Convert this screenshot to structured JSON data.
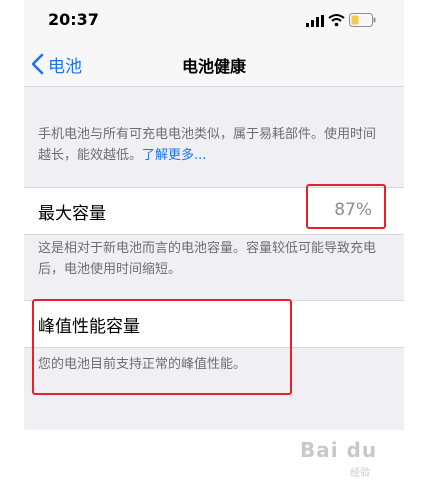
{
  "status_bar": {
    "time": "20:37"
  },
  "nav": {
    "back_label": "电池",
    "title": "电池健康"
  },
  "intro": {
    "text": "手机电池与所有可充电电池类似，属于易耗部件。使用时间越长，能效越低。",
    "link": "了解更多..."
  },
  "max_capacity": {
    "label": "最大容量",
    "value": "87%",
    "footnote": "这是相对于新电池而言的电池容量。容量较低可能导致充电后，电池使用时间缩短。"
  },
  "peak_performance": {
    "label": "峰值性能容量",
    "footnote": "您的电池目前支持正常的峰值性能。"
  },
  "watermark": {
    "brand": "Bai du",
    "sub": "经验"
  },
  "colors": {
    "accent": "#1b74e9",
    "highlight": "#e8202a",
    "battery_level": "#f2c94c"
  }
}
